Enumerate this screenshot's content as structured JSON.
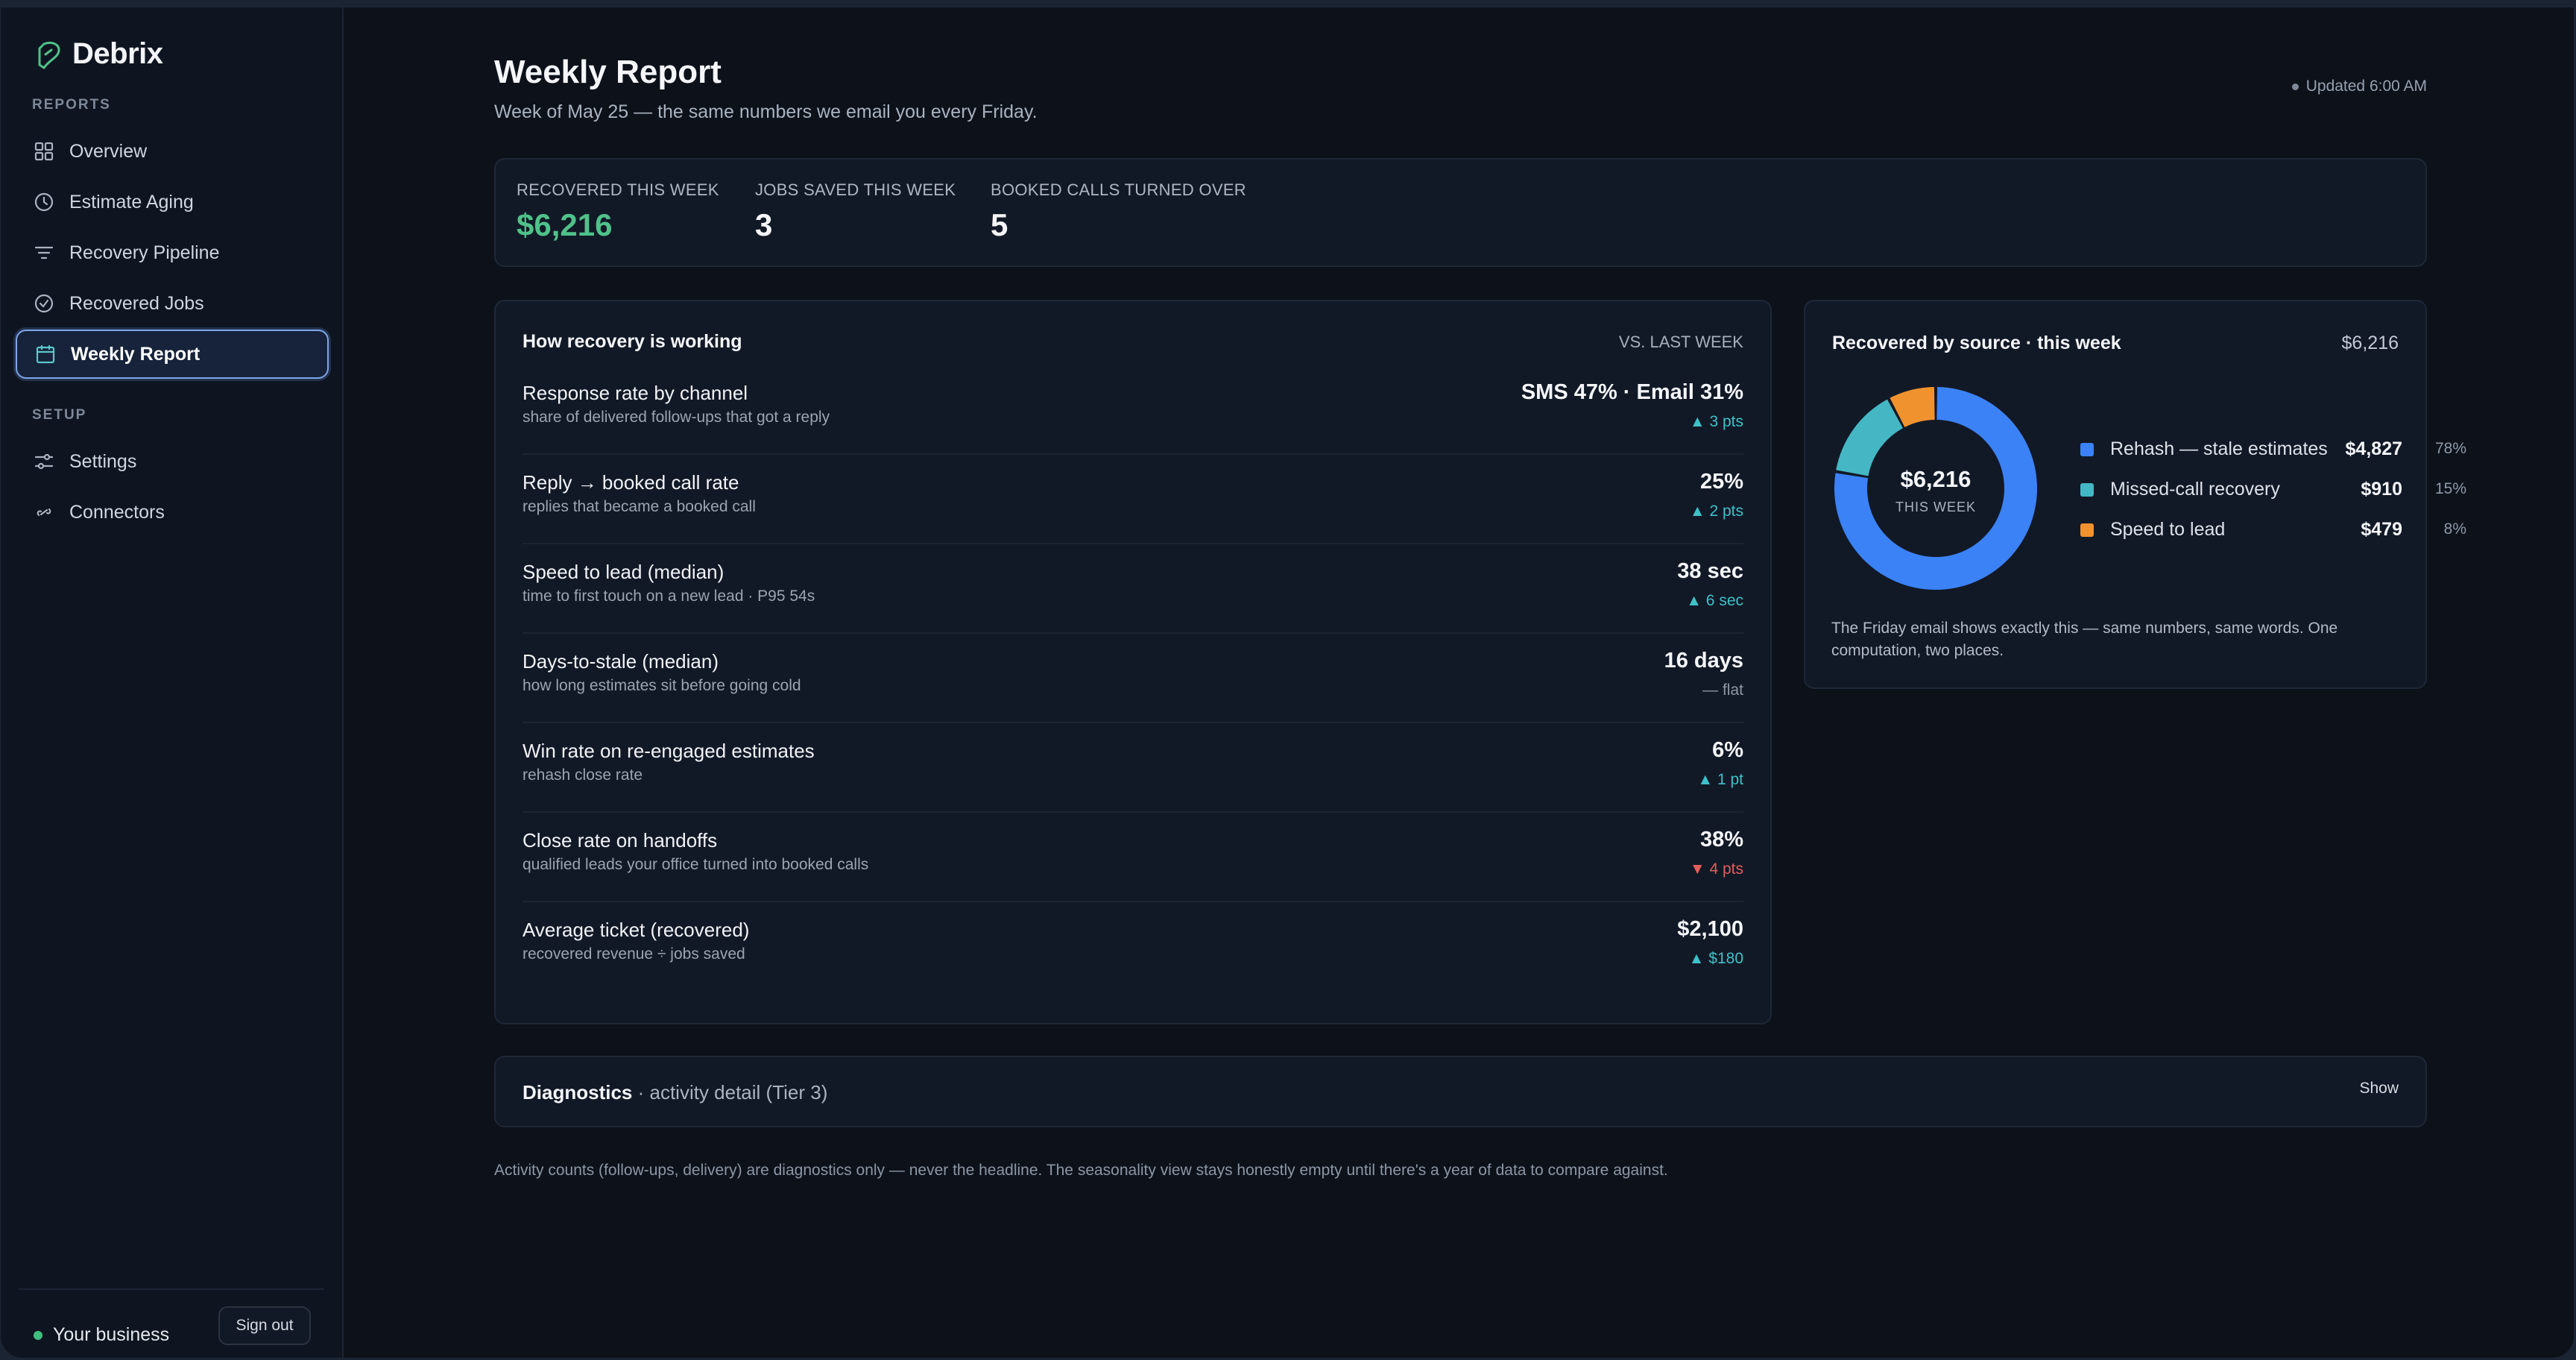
{
  "app": {
    "brand": "Debrix"
  },
  "sidebar": {
    "reports_label": "REPORTS",
    "setup_label": "SETUP",
    "items": [
      {
        "label": "Overview",
        "icon": "grid-icon"
      },
      {
        "label": "Estimate Aging",
        "icon": "clock-icon"
      },
      {
        "label": "Recovery Pipeline",
        "icon": "filter-icon"
      },
      {
        "label": "Recovered Jobs",
        "icon": "check-circle-icon"
      },
      {
        "label": "Weekly Report",
        "icon": "calendar-icon",
        "active": true
      }
    ],
    "setup_items": [
      {
        "label": "Settings",
        "icon": "sliders-icon"
      },
      {
        "label": "Connectors",
        "icon": "link-icon"
      }
    ],
    "footer": {
      "business": "Your business",
      "sign_out": "Sign out"
    }
  },
  "header": {
    "title": "Weekly Report",
    "subtitle": "Week of May 25 — the same numbers we email you every Friday.",
    "updated": "Updated 6:00 AM"
  },
  "summary": [
    {
      "label": "RECOVERED THIS WEEK",
      "value": "$6,216"
    },
    {
      "label": "JOBS SAVED THIS WEEK",
      "value": "3"
    },
    {
      "label": "BOOKED CALLS TURNED OVER",
      "value": "5"
    }
  ],
  "recovery": {
    "title": "How recovery is working",
    "compare_label": "VS. LAST WEEK",
    "metrics": [
      {
        "title": "Response rate by channel",
        "desc": "share of delivered follow-ups that got a reply",
        "value": "SMS 47% · Email 31%",
        "delta": "▲ 3 pts",
        "trend": "up"
      },
      {
        "title": "Reply → booked call rate",
        "desc": "replies that became a booked call",
        "value": "25%",
        "delta": "▲ 2 pts",
        "trend": "up"
      },
      {
        "title": "Speed to lead (median)",
        "desc": "time to first touch on a new lead · P95 54s",
        "value": "38 sec",
        "delta": "▲ 6 sec",
        "trend": "up"
      },
      {
        "title": "Days-to-stale (median)",
        "desc": "how long estimates sit before going cold",
        "value": "16 days",
        "delta": "— flat",
        "trend": "flat"
      },
      {
        "title": "Win rate on re-engaged estimates",
        "desc": "rehash close rate",
        "value": "6%",
        "delta": "▲ 1 pt",
        "trend": "up"
      },
      {
        "title": "Close rate on handoffs",
        "desc": "qualified leads your office turned into booked calls",
        "value": "38%",
        "delta": "▼ 4 pts",
        "trend": "down"
      },
      {
        "title": "Average ticket (recovered)",
        "desc": "recovered revenue ÷ jobs saved",
        "value": "$2,100",
        "delta": "▲ $180",
        "trend": "up"
      }
    ]
  },
  "source": {
    "title": "Recovered by source · this week",
    "total": "$6,216",
    "center_value": "$6,216",
    "center_label": "THIS WEEK",
    "note": "The Friday email shows exactly this — same numbers, same words. One computation, two places."
  },
  "chart_data": {
    "type": "pie",
    "categories": [
      "Rehash — stale estimates",
      "Missed-call recovery",
      "Speed to lead"
    ],
    "values": [
      4827,
      910,
      479
    ],
    "value_labels": [
      "$4,827",
      "$910",
      "$479"
    ],
    "percent_labels": [
      "78%",
      "15%",
      "8%"
    ],
    "colors": [
      "#3b82f6",
      "#45b7c4",
      "#f0922e"
    ],
    "donut": true
  },
  "diagnostics": {
    "title": "Diagnostics",
    "detail": " · activity detail (Tier 3)",
    "button": "Show"
  },
  "footnote": "Activity counts (follow-ups, delivery) are diagnostics only — never the headline. The seasonality view stays honestly empty until there's a year of data to compare against."
}
